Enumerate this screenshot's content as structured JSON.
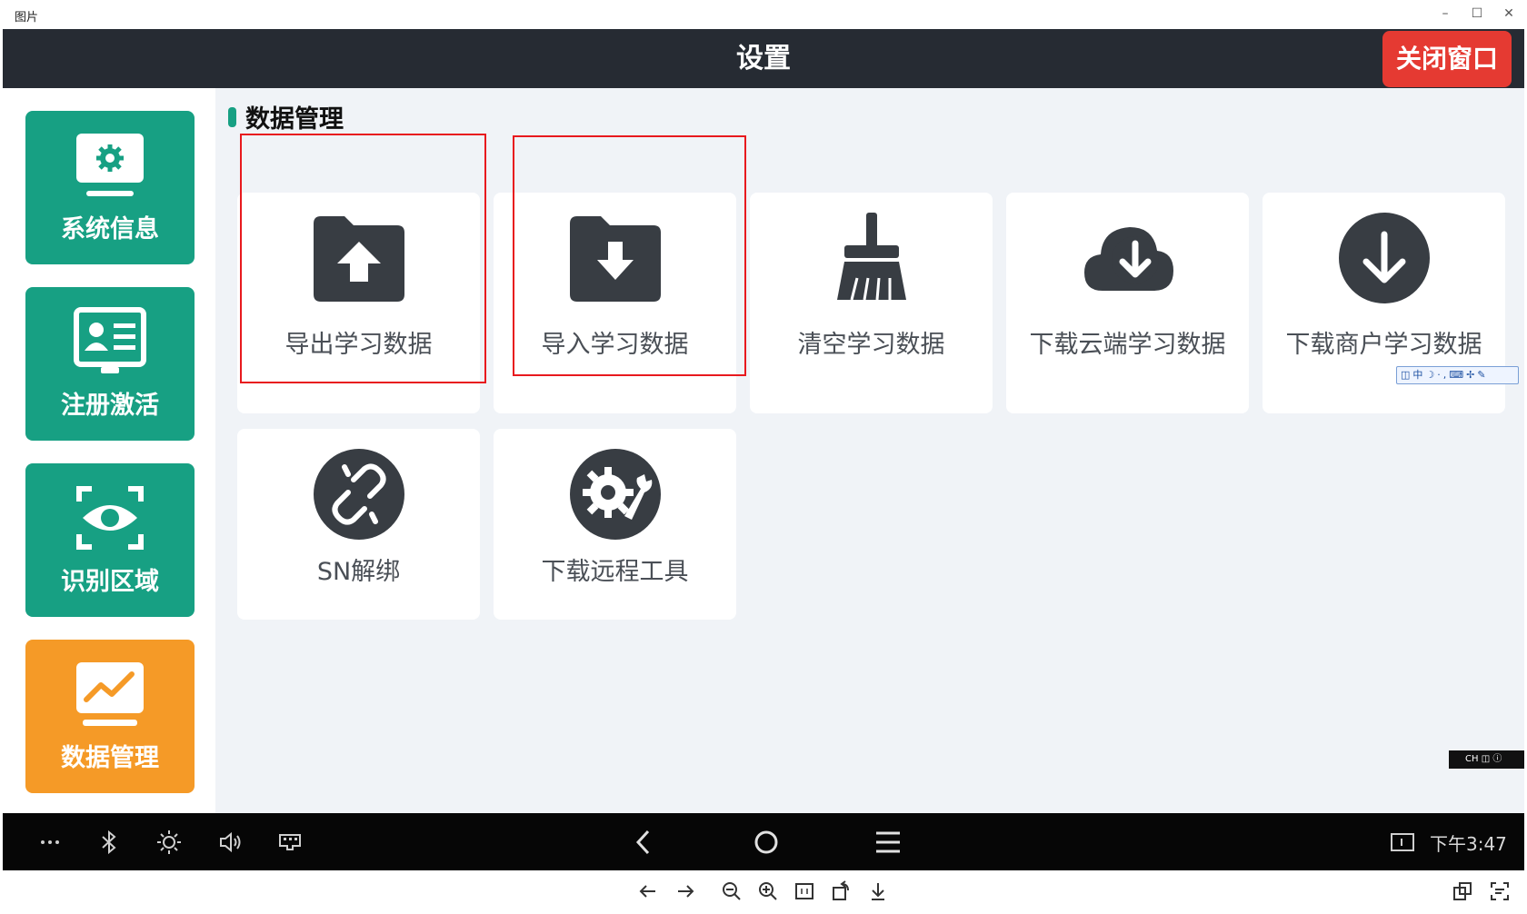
{
  "viewer": {
    "title": "图片",
    "minimize": "–",
    "maximize": "☐",
    "close": "✕"
  },
  "app": {
    "title": "设置",
    "close_button": "关闭窗口"
  },
  "sidebar": {
    "items": [
      {
        "label": "系统信息",
        "icon": "monitor-gear-icon",
        "active": false
      },
      {
        "label": "注册激活",
        "icon": "id-card-icon",
        "active": false
      },
      {
        "label": "识别区域",
        "icon": "eye-scan-icon",
        "active": false
      },
      {
        "label": "数据管理",
        "icon": "chart-monitor-icon",
        "active": true
      }
    ],
    "colors": {
      "normal": "#17a083",
      "active": "#f59a27"
    }
  },
  "section": {
    "title": "数据管理"
  },
  "cards": [
    {
      "label": "导出学习数据",
      "icon": "folder-upload-icon",
      "highlighted": true
    },
    {
      "label": "导入学习数据",
      "icon": "folder-download-icon",
      "highlighted": true
    },
    {
      "label": "清空学习数据",
      "icon": "broom-icon",
      "highlighted": false
    },
    {
      "label": "下载云端学习数据",
      "icon": "cloud-download-icon",
      "highlighted": false
    },
    {
      "label": "下载商户学习数据",
      "icon": "circle-arrow-down-icon",
      "highlighted": false
    },
    {
      "label": "SN解绑",
      "icon": "unlink-icon",
      "highlighted": false
    },
    {
      "label": "下载远程工具",
      "icon": "gear-wrench-icon",
      "highlighted": false
    }
  ],
  "ime": {
    "toolbar": "中",
    "status": "CH"
  },
  "navbar": {
    "time": "下午3:47",
    "icons": [
      "more-icon",
      "bluetooth-icon",
      "brightness-icon",
      "volume-icon",
      "keyboard-icon",
      "back-icon",
      "home-icon",
      "menu-icon",
      "screen-icon"
    ]
  },
  "toolbar": {
    "icons": [
      "previous-icon",
      "next-icon",
      "zoom-out-icon",
      "zoom-in-icon",
      "actual-size-icon",
      "rotate-icon",
      "download-icon",
      "copy-icon",
      "ocr-icon"
    ]
  }
}
